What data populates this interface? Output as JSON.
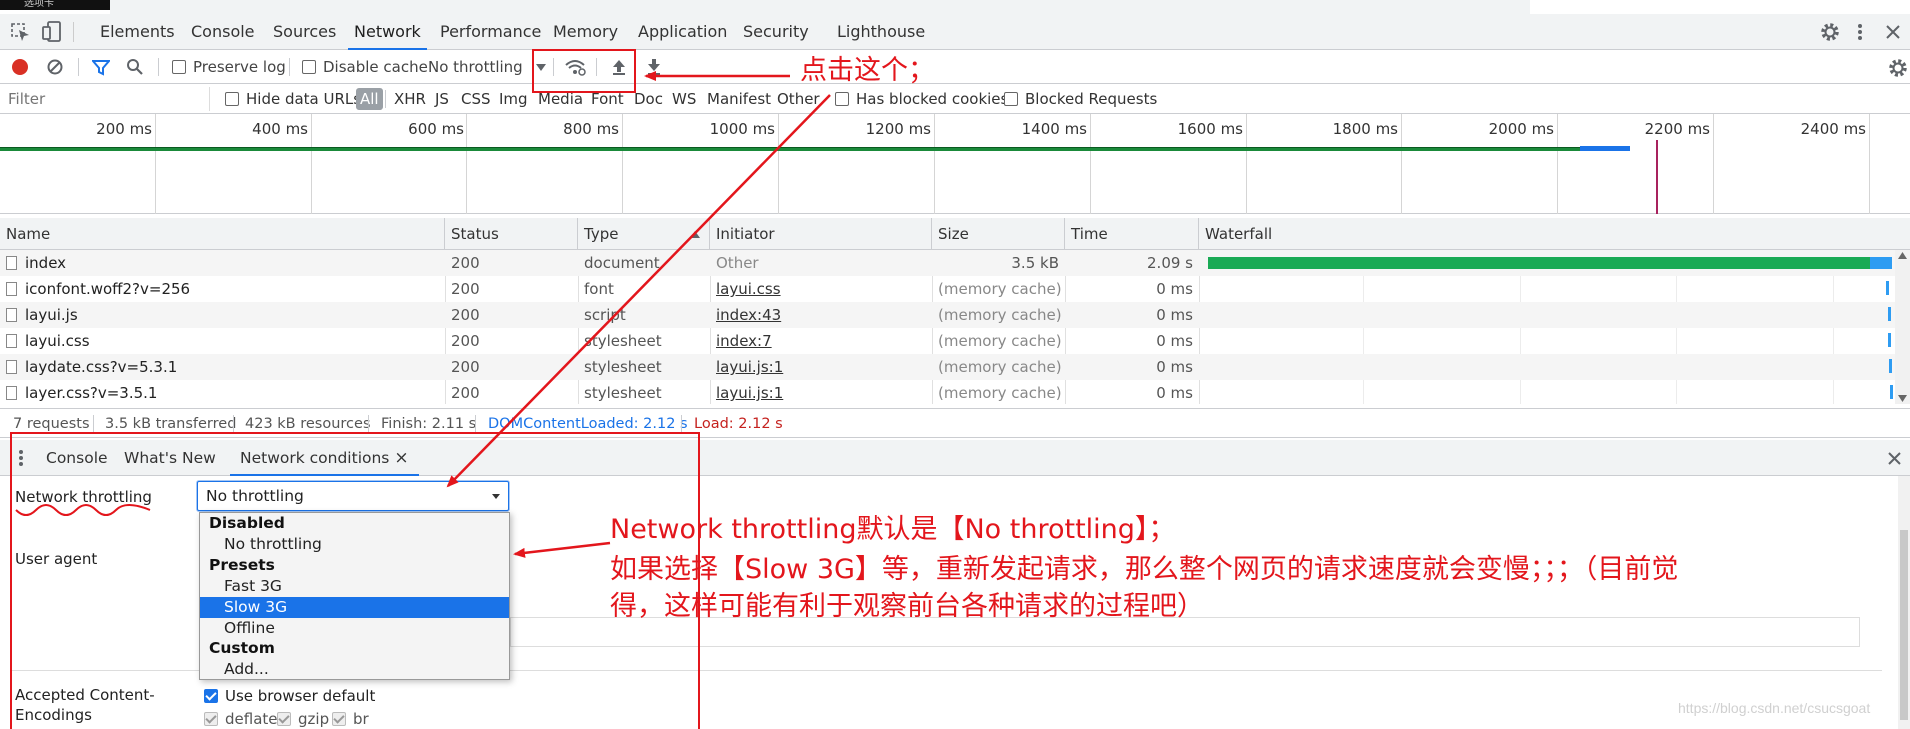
{
  "corner_text": "选项卡",
  "tabs": [
    "Elements",
    "Console",
    "Sources",
    "Network",
    "Performance",
    "Memory",
    "Application",
    "Security",
    "Lighthouse"
  ],
  "active_tab": "Network",
  "icons": {
    "inspect": "inspect-icon",
    "device": "device-toolbar-icon",
    "settings": "gear-icon",
    "more": "more-vert-icon",
    "close": "close-icon",
    "record": "record-icon",
    "clear": "clear-icon",
    "filter": "filter-icon",
    "search": "search-icon",
    "online": "network-conditions-icon",
    "upload": "import-har-icon",
    "download": "export-har-icon"
  },
  "toolbar": {
    "preserve_log": "Preserve log",
    "disable_cache": "Disable cache",
    "throttling": "No throttling"
  },
  "filterbar": {
    "placeholder": "Filter",
    "hide_data_urls": "Hide data URLs",
    "types": [
      "All",
      "XHR",
      "JS",
      "CSS",
      "Img",
      "Media",
      "Font",
      "Doc",
      "WS",
      "Manifest",
      "Other"
    ],
    "has_blocked_cookies": "Has blocked cookies",
    "blocked_requests": "Blocked Requests"
  },
  "overview": {
    "ticks": [
      "200 ms",
      "400 ms",
      "600 ms",
      "800 ms",
      "1000 ms",
      "1200 ms",
      "1400 ms",
      "1600 ms",
      "1800 ms",
      "2000 ms",
      "2200 ms",
      "2400 ms"
    ]
  },
  "grid": {
    "columns": [
      "Name",
      "Status",
      "Type",
      "Initiator",
      "Size",
      "Time",
      "Waterfall"
    ],
    "rows": [
      {
        "name": "index",
        "status": "200",
        "type": "document",
        "initiator": "Other",
        "size": "3.5 kB",
        "time": "2.09 s"
      },
      {
        "name": "iconfont.woff2?v=256",
        "status": "200",
        "type": "font",
        "initiator": "layui.css",
        "size": "(memory cache)",
        "time": "0 ms"
      },
      {
        "name": "layui.js",
        "status": "200",
        "type": "script",
        "initiator": "index:43",
        "size": "(memory cache)",
        "time": "0 ms"
      },
      {
        "name": "layui.css",
        "status": "200",
        "type": "stylesheet",
        "initiator": "index:7",
        "size": "(memory cache)",
        "time": "0 ms"
      },
      {
        "name": "laydate.css?v=5.3.1",
        "status": "200",
        "type": "stylesheet",
        "initiator": "layui.js:1",
        "size": "(memory cache)",
        "time": "0 ms"
      },
      {
        "name": "layer.css?v=3.5.1",
        "status": "200",
        "type": "stylesheet",
        "initiator": "layui.js:1",
        "size": "(memory cache)",
        "time": "0 ms"
      }
    ]
  },
  "status": {
    "requests": "7 requests",
    "transferred": "3.5 kB transferred",
    "resources": "423 kB resources",
    "finish": "Finish: 2.11 s",
    "dcl": "DOMContentLoaded: 2.12 s",
    "load": "Load: 2.12 s"
  },
  "drawer": {
    "tabs": [
      "Console",
      "What's New",
      "Network conditions"
    ],
    "active_tab": "Network conditions",
    "close_tab": "×",
    "network_throttling_label": "Network throttling",
    "selected": "No throttling",
    "dropdown": {
      "group_disabled": "Disabled",
      "no_throttling": "No throttling",
      "group_presets": "Presets",
      "fast3g": "Fast 3G",
      "slow3g": "Slow 3G",
      "offline": "Offline",
      "group_custom": "Custom",
      "add": "Add..."
    },
    "user_agent_label": "User agent",
    "accepted_label_1": "Accepted Content-",
    "accepted_label_2": "Encodings",
    "use_browser_default": "Use browser default",
    "encodings": [
      "deflate",
      "gzip",
      "br"
    ]
  },
  "annotations": {
    "click_this": "点击这个；",
    "line1": "Network throttling默认是【No throttling】；",
    "line2": "如果选择【Slow 3G】等，重新发起请求，那么整个网页的请求速度就会变慢；；；（目前觉",
    "line3": "得，这样可能有利于观察前台各种请求的过程吧）",
    "color": "#e3161c"
  },
  "watermark": "https://blog.csdn.net/csucsgoat"
}
